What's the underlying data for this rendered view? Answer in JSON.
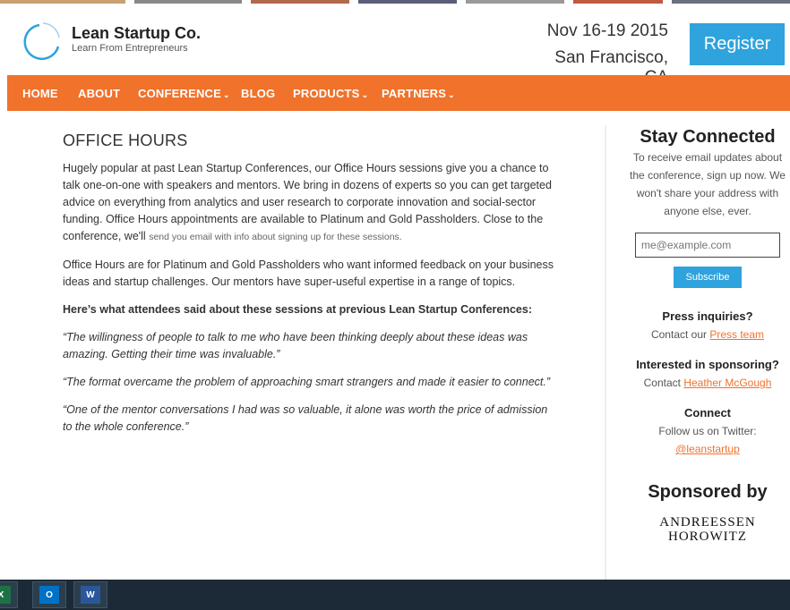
{
  "header": {
    "logo_name": "Lean Startup Co.",
    "logo_tagline": "Learn From Entrepreneurs",
    "event_date": "Nov 16-19 2015",
    "event_location": "San Francisco, CA",
    "register_label": "Register"
  },
  "nav": {
    "items": [
      {
        "label": "HOME"
      },
      {
        "label": "ABOUT"
      },
      {
        "label": "CONFERENCE",
        "dropdown": true
      },
      {
        "label": "BLOG"
      },
      {
        "label": "PRODUCTS",
        "dropdown": true
      },
      {
        "label": "PARTNERS",
        "dropdown": true
      }
    ],
    "chevron": "⌄"
  },
  "main": {
    "title": "OFFICE HOURS",
    "p1": "Hugely popular at past Lean Startup Conferences, our Office Hours sessions give you a chance to talk one-on-one with speakers and mentors. We bring in dozens of experts so you can get targeted advice on everything from analytics and user research to corporate innovation and social-sector funding. Office Hours appointments are available to Platinum and Gold Passholders. Close to the conference, we'll",
    "p1_small": "send you email with info about signing up for these sessions.",
    "p2": "Office Hours are for Platinum and Gold Passholders who want informed feedback on your business ideas and startup challenges. Our mentors have super-useful expertise in a range of topics.",
    "p3": "Here’s what attendees said about these sessions at previous Lean Startup Conferences:",
    "quote1": "“The willingness of people to talk to me who have been thinking deeply about these ideas was amazing. Getting their time was invaluable.”",
    "quote2": "“The format overcame the problem of approaching smart strangers and made it easier to connect.”",
    "quote3": "“One of the mentor conversations I had was so valuable, it alone was worth the price of admission to the whole conference.”"
  },
  "sidebar": {
    "stay_title": "Stay Connected",
    "stay_text": "To receive email updates about the conference, sign up now. We won't share your address with anyone else, ever.",
    "email_placeholder": "me@example.com",
    "subscribe_label": "Subscribe",
    "press_title": "Press inquiries?",
    "press_text": "Contact our ",
    "press_link": "Press team",
    "sponsor_title": "Interested in sponsoring?",
    "sponsor_text": "Contact ",
    "sponsor_link": "Heather McGough",
    "connect_title": "Connect",
    "connect_text": "Follow us on Twitter:",
    "twitter_link": "@leanstartup",
    "sponsored_by": "Sponsored by",
    "sponsor_logo_line1": "ANDREESSEN",
    "sponsor_logo_line2": "HOROWITZ"
  },
  "taskbar": {
    "apps": [
      {
        "name": "excel-icon",
        "glyph": "X",
        "color": "#1e7145"
      },
      {
        "name": "outlook-icon",
        "glyph": "O",
        "color": "#0072c6"
      },
      {
        "name": "word-icon",
        "glyph": "W",
        "color": "#2b579a"
      }
    ]
  },
  "colors": {
    "accent_orange": "#f0722b",
    "accent_blue": "#2ea3dd",
    "taskbar": "#1b2a36"
  }
}
